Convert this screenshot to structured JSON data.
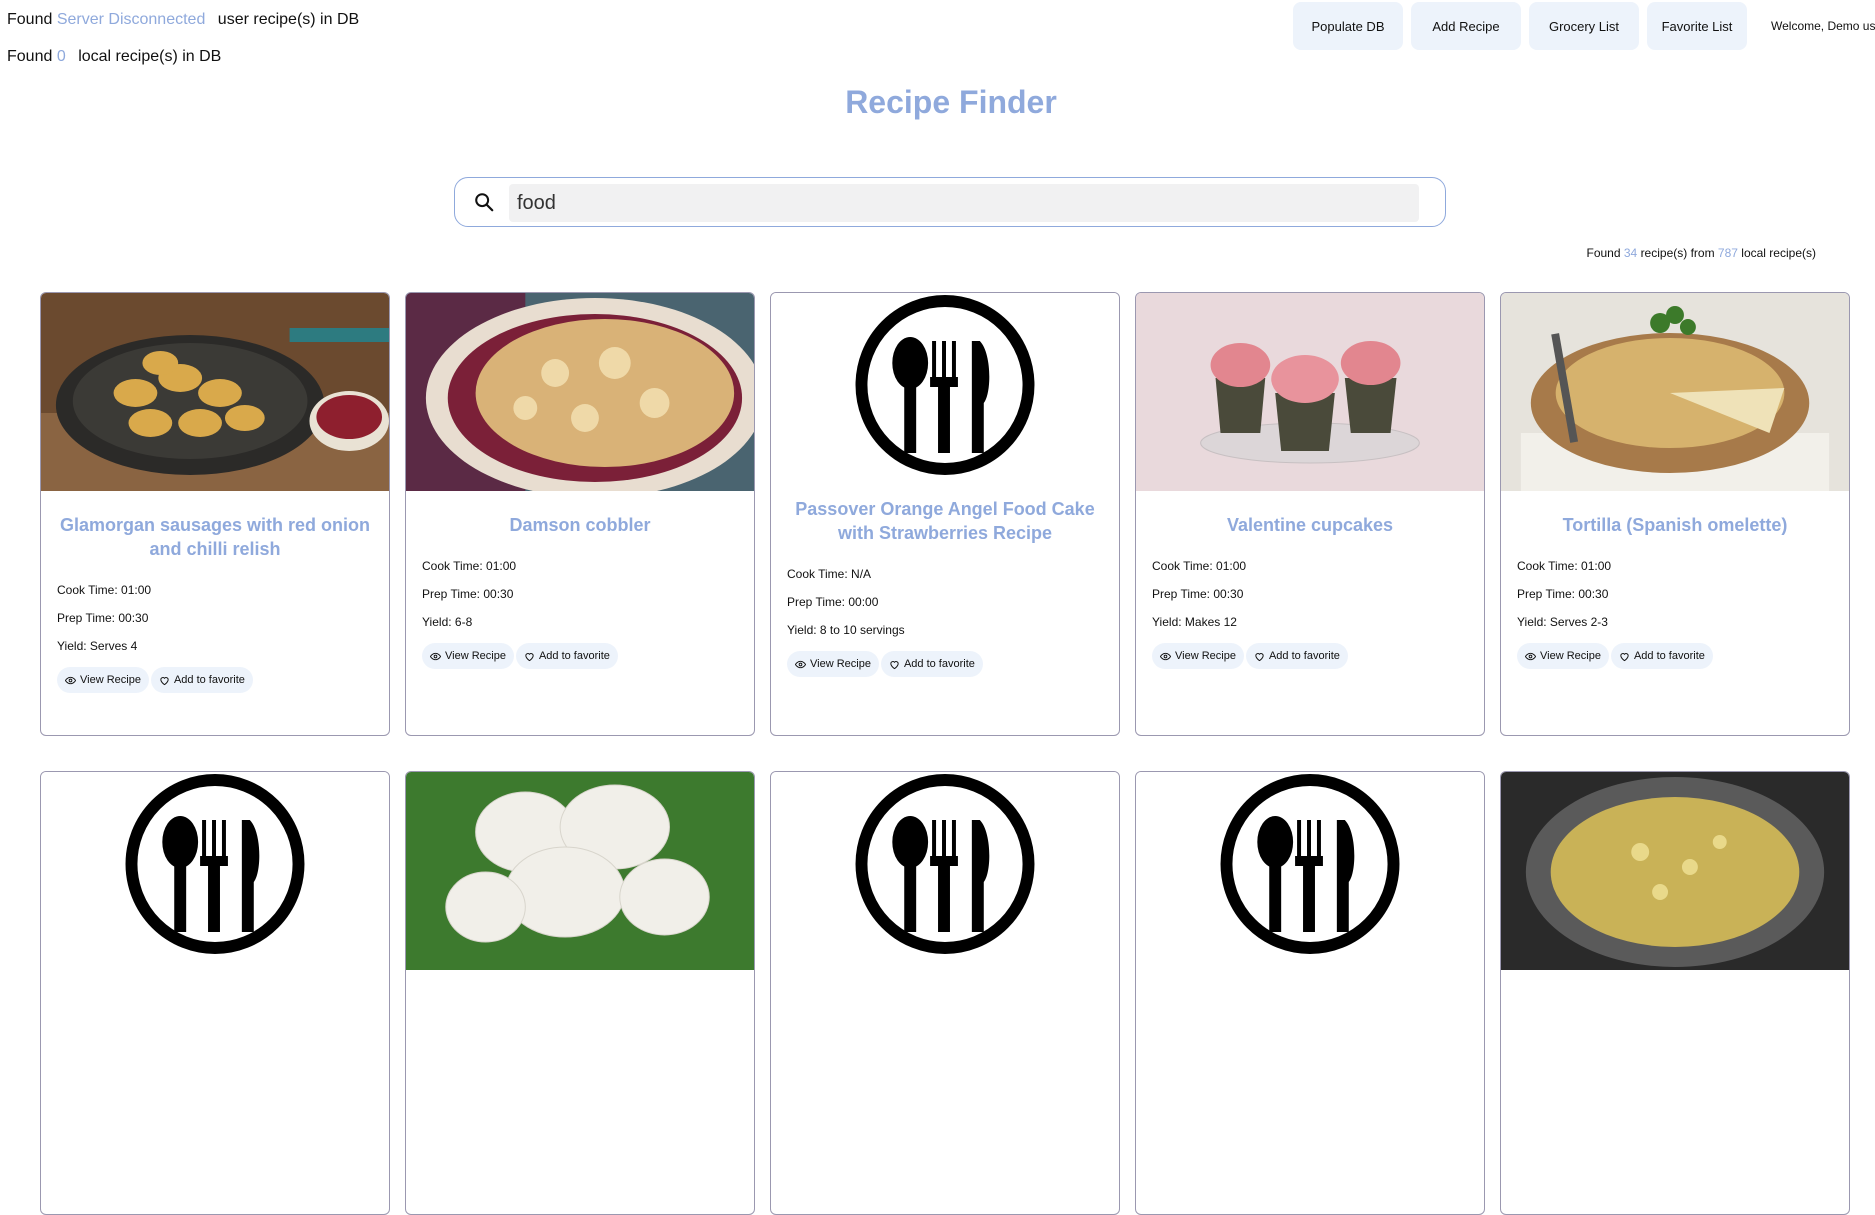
{
  "status": {
    "user_prefix": "Found",
    "user_value": "Server Disconnected",
    "user_suffix": "user recipe(s) in DB",
    "local_prefix": "Found",
    "local_value": "0",
    "local_suffix": "local recipe(s) in DB"
  },
  "nav": {
    "populate": "Populate DB",
    "add": "Add Recipe",
    "grocery": "Grocery List",
    "favorite": "Favorite List",
    "welcome": "Welcome, Demo user"
  },
  "title": "Recipe Finder",
  "search": {
    "value": "food",
    "icon": "search-icon"
  },
  "results": {
    "prefix": "Found",
    "count": "34",
    "middle": "recipe(s) from",
    "total": "787",
    "suffix": "local recipe(s)"
  },
  "labels": {
    "cook": "Cook Time:",
    "prep": "Prep Time:",
    "yield": "Yield:",
    "view": "View Recipe",
    "favorite": "Add to favorite"
  },
  "colors": {
    "accent": "#8fa9dc",
    "button_bg": "#edf3fb",
    "card_border": "#9b98b0"
  },
  "recipes": [
    {
      "title": "Glamorgan sausages with red onion and chilli relish",
      "cook": "01:00",
      "prep": "00:30",
      "yield": "Serves 4",
      "image": "pan-of-sausages"
    },
    {
      "title": "Damson cobbler",
      "cook": "01:00",
      "prep": "00:30",
      "yield": "6-8",
      "image": "cobbler-dish"
    },
    {
      "title": "Passover Orange Angel Food Cake with Strawberries Recipe",
      "cook": "N/A",
      "prep": "00:00",
      "yield": "8 to 10 servings",
      "image": "placeholder-utensils"
    },
    {
      "title": "Valentine cupcakes",
      "cook": "01:00",
      "prep": "00:30",
      "yield": "Makes 12",
      "image": "cupcakes"
    },
    {
      "title": "Tortilla (Spanish omelette)",
      "cook": "01:00",
      "prep": "00:30",
      "yield": "Serves 2-3",
      "image": "tortilla"
    },
    {
      "image": "placeholder-utensils"
    },
    {
      "image": "meringues"
    },
    {
      "image": "placeholder-utensils"
    },
    {
      "image": "placeholder-utensils"
    },
    {
      "image": "rice-pot"
    }
  ]
}
